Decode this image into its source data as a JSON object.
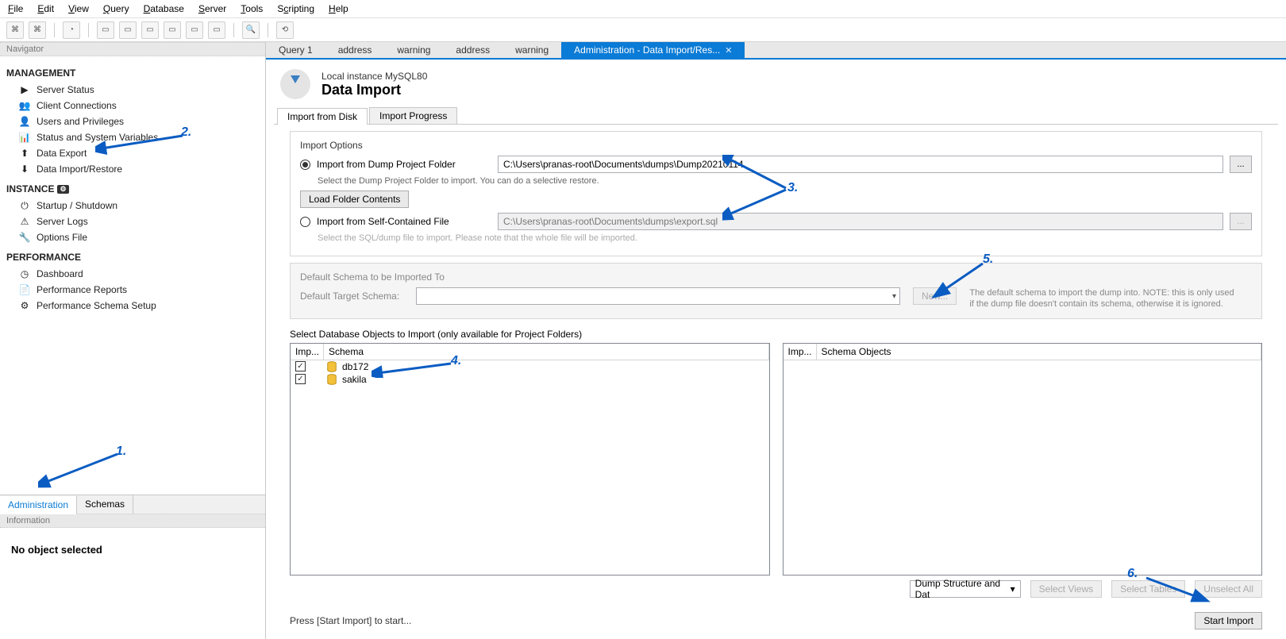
{
  "menu": [
    "File",
    "Edit",
    "View",
    "Query",
    "Database",
    "Server",
    "Tools",
    "Scripting",
    "Help"
  ],
  "navigator": {
    "title": "Navigator",
    "management": {
      "heading": "MANAGEMENT",
      "items": [
        "Server Status",
        "Client Connections",
        "Users and Privileges",
        "Status and System Variables",
        "Data Export",
        "Data Import/Restore"
      ]
    },
    "instance": {
      "heading": "INSTANCE",
      "items": [
        "Startup / Shutdown",
        "Server Logs",
        "Options File"
      ]
    },
    "performance": {
      "heading": "PERFORMANCE",
      "items": [
        "Dashboard",
        "Performance Reports",
        "Performance Schema Setup"
      ]
    },
    "tabs": [
      "Administration",
      "Schemas"
    ]
  },
  "information": {
    "title": "Information",
    "body": "No object selected"
  },
  "editor_tabs": [
    "Query 1",
    "address",
    "warning",
    "address",
    "warning",
    "Administration - Data Import/Res..."
  ],
  "page": {
    "sub": "Local instance MySQL80",
    "title": "Data Import"
  },
  "inner_tabs": [
    "Import from Disk",
    "Import Progress"
  ],
  "import_options": {
    "title": "Import Options",
    "opt1_label": "Import from Dump Project Folder",
    "opt1_value": "C:\\Users\\pranas-root\\Documents\\dumps\\Dump20210114",
    "opt1_help": "Select the Dump Project Folder to import. You can do a selective restore.",
    "load_btn": "Load Folder Contents",
    "opt2_label": "Import from Self-Contained File",
    "opt2_value": "C:\\Users\\pranas-root\\Documents\\dumps\\export.sql",
    "opt2_help": "Select the SQL/dump file to import. Please note that the whole file will be imported.",
    "browse": "..."
  },
  "default_schema": {
    "title": "Default Schema to be Imported To",
    "label": "Default Target Schema:",
    "new_btn": "New...",
    "note": "The default schema to import the dump into. NOTE: this is only used if the dump file doesn't contain its schema, otherwise it is ignored."
  },
  "objects": {
    "title": "Select Database Objects to Import (only available for Project Folders)",
    "left_cols": [
      "Imp...",
      "Schema"
    ],
    "right_cols": [
      "Imp...",
      "Schema Objects"
    ],
    "schemas": [
      "db172",
      "sakila"
    ],
    "dump_type": "Dump Structure and Dat",
    "btn_views": "Select Views",
    "btn_tables": "Select Tables",
    "btn_unselect": "Unselect All"
  },
  "footer": {
    "status": "Press [Start Import] to start...",
    "start_btn": "Start Import"
  },
  "annotations": {
    "n1": "1.",
    "n2": "2.",
    "n3": "3.",
    "n4": "4.",
    "n5": "5.",
    "n6": "6."
  }
}
